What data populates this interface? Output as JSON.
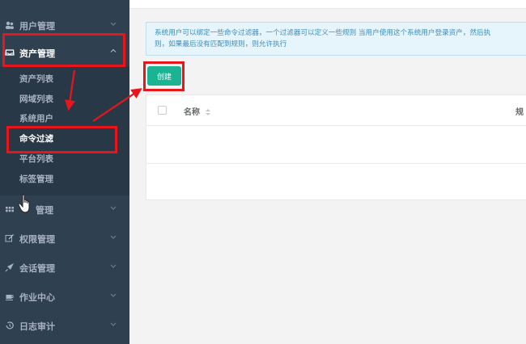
{
  "sidebar": {
    "items": [
      {
        "label": "用户管理",
        "icon": "users-icon"
      },
      {
        "label": "资产管理",
        "icon": "inbox-icon"
      },
      {
        "label": "管理",
        "icon": "grid-icon"
      },
      {
        "label": "权限管理",
        "icon": "edit-icon"
      },
      {
        "label": "会话管理",
        "icon": "rocket-icon"
      },
      {
        "label": "作业中心",
        "icon": "coffee-icon"
      },
      {
        "label": "日志审计",
        "icon": "history-icon"
      }
    ],
    "asset_submenu": [
      {
        "label": "资产列表"
      },
      {
        "label": "网域列表"
      },
      {
        "label": "系统用户"
      },
      {
        "label": "命令过滤"
      },
      {
        "label": "平台列表"
      },
      {
        "label": "标签管理"
      }
    ]
  },
  "alert": {
    "line1": "系统用户可以绑定一些命令过滤器，一个过滤器可以定义一些规则 当用户使用这个系统用户登录资产，然后执",
    "line2": "则，如果最后没有匹配到规则，则允许执行"
  },
  "toolbar": {
    "create_label": "创建"
  },
  "table": {
    "columns": [
      {
        "label": "名称"
      },
      {
        "label": "规"
      }
    ]
  },
  "colors": {
    "sidebar_bg": "#2f4050",
    "submenu_bg": "#293846",
    "accent": "#1ab394",
    "annotation": "#e8151b"
  }
}
